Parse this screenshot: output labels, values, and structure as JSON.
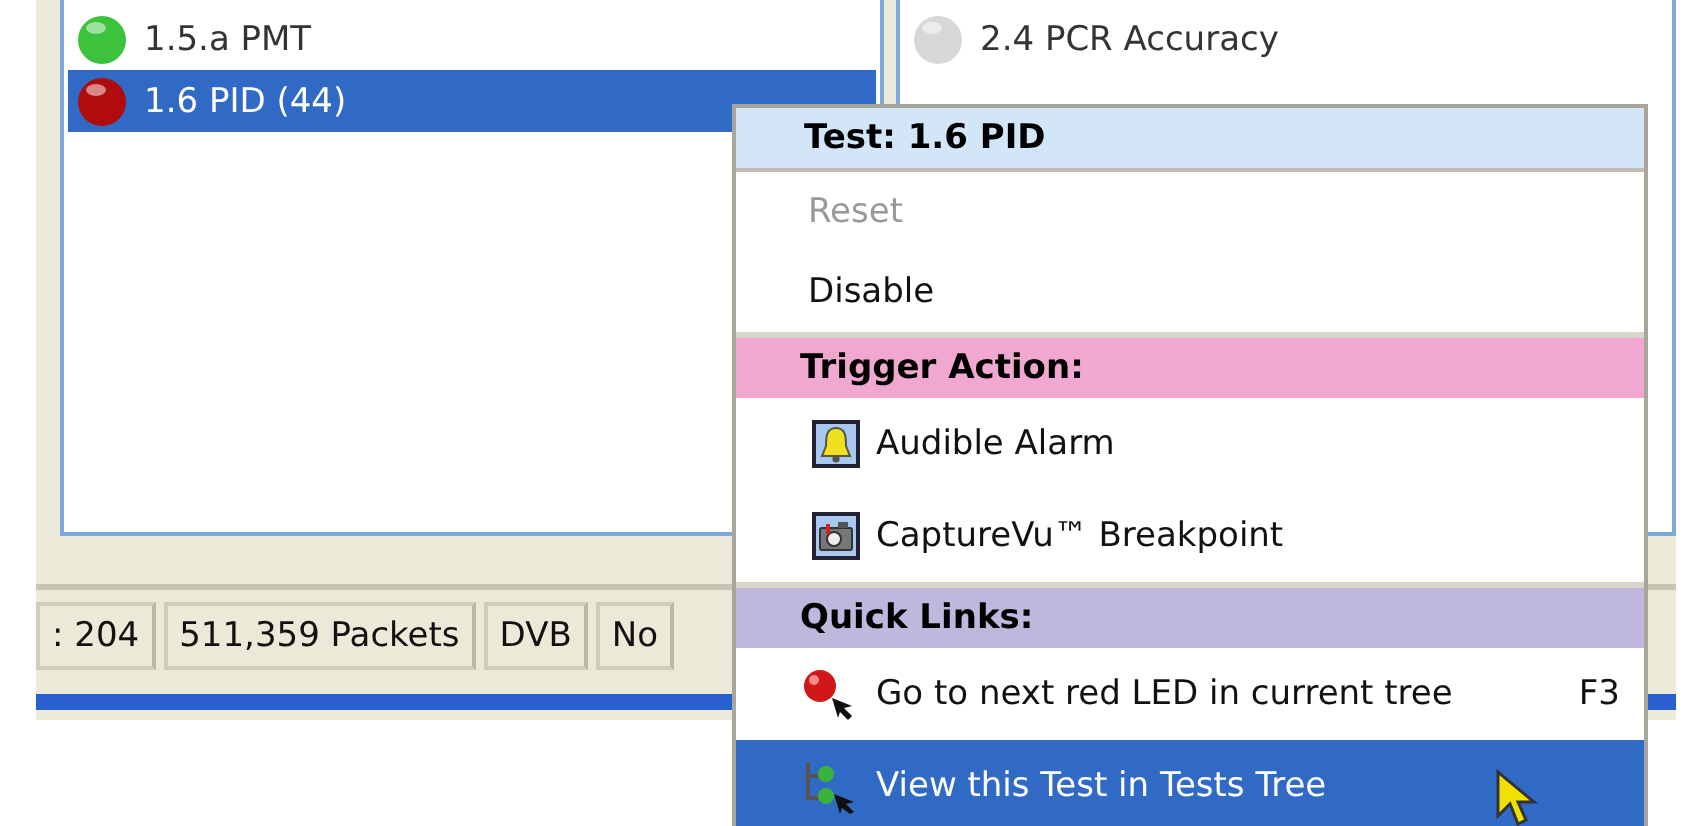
{
  "tree_left": {
    "items": [
      {
        "label": "1.5.a PMT",
        "color": "#3cc23c",
        "selected": false
      },
      {
        "label": "1.6 PID (44)",
        "color": "#b00c0c",
        "selected": true
      }
    ]
  },
  "tree_right": {
    "items": [
      {
        "label": "2.4 PCR Accuracy",
        "color": "#d8d8d8",
        "selected": false
      }
    ]
  },
  "status_bar": [
    ": 204",
    "511,359 Packets",
    "DVB",
    "No"
  ],
  "context_menu": {
    "title": "Test: 1.6 PID",
    "items": [
      {
        "kind": "command",
        "label": "Reset",
        "disabled": true,
        "selected": false
      },
      {
        "kind": "command",
        "label": "Disable",
        "disabled": false,
        "selected": false
      },
      {
        "kind": "section",
        "label": "Trigger Action:",
        "color": "#f0a8d0"
      },
      {
        "kind": "command",
        "label": "Audible Alarm",
        "disabled": false,
        "selected": false
      },
      {
        "kind": "command",
        "label": "CaptureVu™ Breakpoint",
        "disabled": false,
        "selected": false
      },
      {
        "kind": "section",
        "label": "Quick Links:",
        "color": "#c0b8dc"
      },
      {
        "kind": "command",
        "label": "Go to next red LED in current tree",
        "shortcut": "F3",
        "disabled": false,
        "selected": false
      },
      {
        "kind": "command",
        "label": "View this Test in Tests Tree",
        "disabled": false,
        "selected": true
      }
    ]
  }
}
